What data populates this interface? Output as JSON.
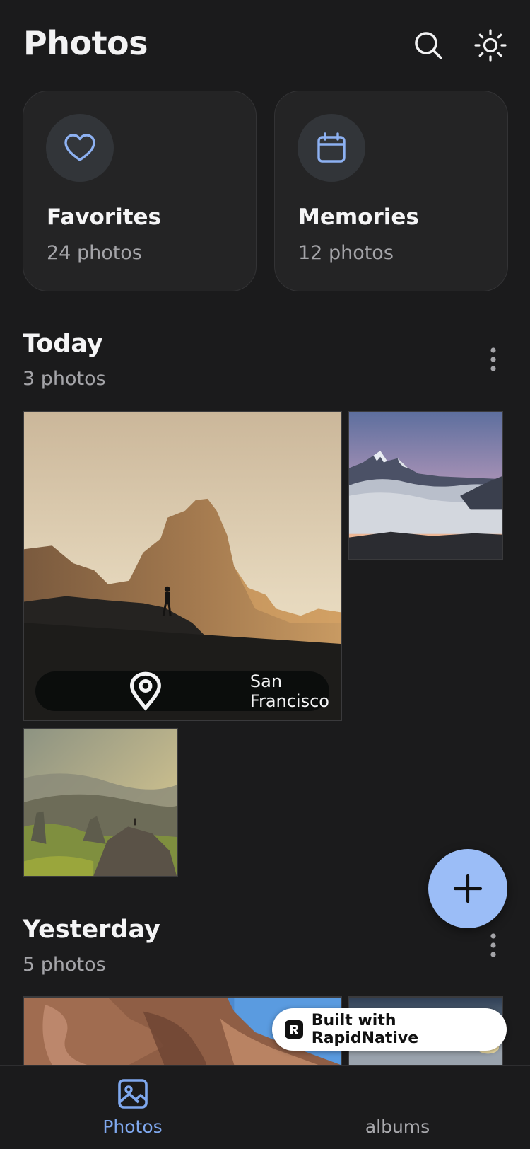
{
  "header": {
    "title": "Photos",
    "search_icon": "search-icon",
    "theme_icon": "sun-icon"
  },
  "quick_cards": [
    {
      "title": "Favorites",
      "count": "24 photos",
      "icon": "heart-icon"
    },
    {
      "title": "Memories",
      "count": "12 photos",
      "icon": "calendar-icon"
    }
  ],
  "sections": [
    {
      "title": "Today",
      "count": "3 photos",
      "photos": [
        {
          "scene": "desert mountain silhouette with hiker at sunset",
          "location": "San Francisco"
        },
        {
          "scene": "snowy peaks above sea of clouds at dusk"
        },
        {
          "scene": "misty green hills with lone figure on rocks"
        }
      ]
    },
    {
      "title": "Yesterday",
      "count": "5 photos",
      "photos": [
        {
          "scene": "red rock canyon under blue sky"
        },
        {
          "scene": "cloudy mountain horizon"
        }
      ]
    }
  ],
  "fab": {
    "icon": "plus-icon"
  },
  "badge": {
    "text": "Built with RapidNative"
  },
  "tabs": [
    {
      "label": "Photos",
      "icon": "image-icon",
      "active": true
    },
    {
      "label": "albums",
      "icon": "album-icon",
      "active": false
    }
  ],
  "colors": {
    "background": "#1b1b1c",
    "card": "#242425",
    "accent": "#7fa8ee",
    "fab": "#9bbdf7",
    "muted_text": "#a4a4a8"
  }
}
